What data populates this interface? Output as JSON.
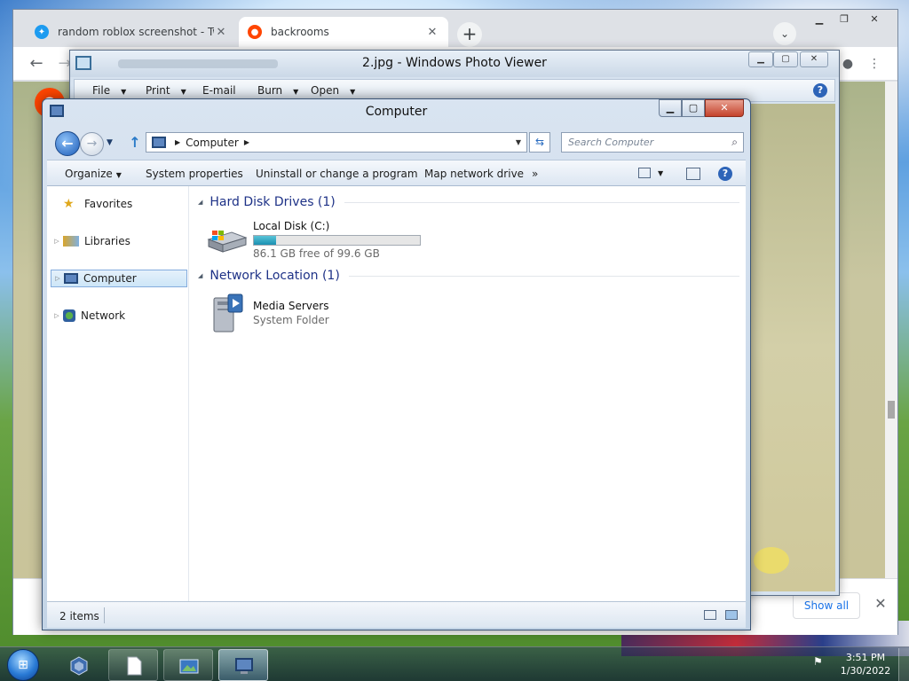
{
  "browser": {
    "tabs": [
      {
        "title": "random roblox screenshot - Twi",
        "icon": "twitter-icon",
        "active": false
      },
      {
        "title": "backrooms",
        "icon": "reddit-icon",
        "active": true
      }
    ],
    "new_tab": "+",
    "tab_search": "⌄",
    "downloads": {
      "show_all": "Show all",
      "close": "✕"
    }
  },
  "photo_viewer": {
    "title": "2.jpg - Windows Photo Viewer",
    "menu": [
      {
        "label": "File"
      },
      {
        "label": "Print"
      },
      {
        "label": "E-mail"
      },
      {
        "label": "Burn"
      },
      {
        "label": "Open"
      }
    ],
    "help": "?"
  },
  "explorer": {
    "title": "Computer",
    "address": {
      "segments": [
        "Computer"
      ]
    },
    "search_placeholder": "Search Computer",
    "commands": [
      {
        "label": "Organize",
        "dropdown": true
      },
      {
        "label": "System properties",
        "dropdown": false
      },
      {
        "label": "Uninstall or change a program",
        "dropdown": false
      },
      {
        "label": "Map network drive",
        "dropdown": false
      },
      {
        "label": "»",
        "dropdown": false
      }
    ],
    "nav": [
      {
        "label": "Favorites",
        "icon": "star-icon",
        "expandable": false,
        "selected": false
      },
      {
        "label": "Libraries",
        "icon": "libraries-icon",
        "expandable": true,
        "selected": false
      },
      {
        "label": "Computer",
        "icon": "computer-icon",
        "expandable": true,
        "selected": true
      },
      {
        "label": "Network",
        "icon": "network-icon",
        "expandable": true,
        "selected": false
      }
    ],
    "groups": {
      "hard_disk": {
        "heading": "Hard Disk Drives (1)",
        "drive": {
          "name": "Local Disk (C:)",
          "free_text": "86.1 GB free of 99.6 GB",
          "used_fraction": 0.136
        }
      },
      "network": {
        "heading": "Network Location (1)",
        "item": {
          "name": "Media Servers",
          "type": "System Folder"
        }
      }
    },
    "status": {
      "count": "2 items"
    }
  },
  "taskbar": {
    "clock_time": "3:51 PM",
    "clock_date": "1/30/2022"
  },
  "colors": {
    "explorer_heading": "#1e3287",
    "reddit": "#ff4500",
    "twitter": "#1d9bf0",
    "drive_fill": "#1b90b1"
  }
}
